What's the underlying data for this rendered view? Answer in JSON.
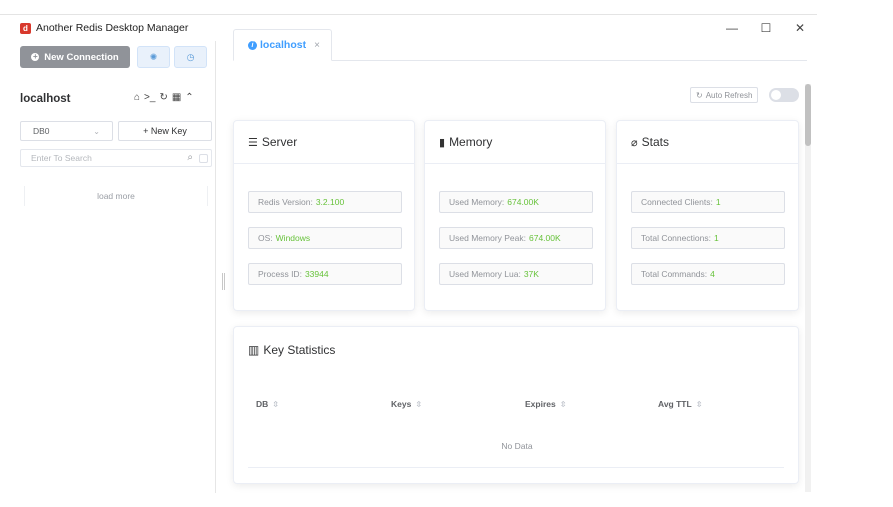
{
  "window": {
    "title": "Another Redis Desktop Manager",
    "logo_letter": "d",
    "controls": {
      "minimize": "—",
      "maximize": "☐",
      "close": "✕"
    }
  },
  "left": {
    "new_connection_label": "New Connection",
    "connection_name": "localhost",
    "db_select": {
      "value": "DB0"
    },
    "new_key_label": "+ New Key",
    "search": {
      "placeholder": "Enter To Search"
    },
    "load_more": "load more"
  },
  "tab": {
    "label": "localhost",
    "close": "×"
  },
  "toolbar": {
    "auto_refresh_label": "Auto Refresh",
    "auto_refresh_on": false
  },
  "server": {
    "title": "Server",
    "items": [
      {
        "label": "Redis Version:",
        "value": "3.2.100"
      },
      {
        "label": "OS:",
        "value": "Windows"
      },
      {
        "label": "Process ID:",
        "value": "33944"
      }
    ]
  },
  "memory": {
    "title": "Memory",
    "items": [
      {
        "label": "Used Memory:",
        "value": "674.00K"
      },
      {
        "label": "Used Memory Peak:",
        "value": "674.00K"
      },
      {
        "label": "Used Memory Lua:",
        "value": "37K"
      }
    ]
  },
  "stats": {
    "title": "Stats",
    "items": [
      {
        "label": "Connected Clients:",
        "value": "1"
      },
      {
        "label": "Total Connections:",
        "value": "1"
      },
      {
        "label": "Total Commands:",
        "value": "4"
      }
    ]
  },
  "key_statistics": {
    "title": "Key Statistics",
    "columns": [
      "DB",
      "Keys",
      "Expires",
      "Avg TTL"
    ],
    "empty_text": "No Data"
  },
  "colors": {
    "accent": "#409eff",
    "value_green": "#67c23a",
    "new_connection_bg": "#909399",
    "logo_red": "#d8382c"
  }
}
